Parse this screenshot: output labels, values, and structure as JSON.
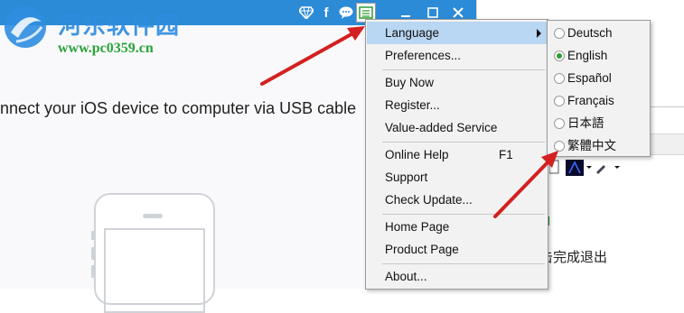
{
  "watermark": {
    "title": "河东软件园",
    "url": "www.pc0359.cn"
  },
  "app": {
    "connect_text": "nnect your iOS device to computer via USB cable"
  },
  "titlebar_icons": [
    "diamond-icon",
    "facebook-icon",
    "chat-icon",
    "menu-icon",
    "minimize-icon",
    "maximize-icon",
    "close-icon"
  ],
  "menu": {
    "language": "Language",
    "preferences": "Preferences...",
    "buy_now": "Buy Now",
    "register": "Register...",
    "value_added": "Value-added Service",
    "online_help": "Online Help",
    "online_help_shortcut": "F1",
    "support": "Support",
    "check_update": "Check Update...",
    "home_page": "Home Page",
    "product_page": "Product Page",
    "about": "About..."
  },
  "languages": [
    {
      "label": "Deutsch",
      "selected": false
    },
    {
      "label": "English",
      "selected": true
    },
    {
      "label": "Español",
      "selected": false
    },
    {
      "label": "Français",
      "selected": false
    },
    {
      "label": "日本語",
      "selected": false
    },
    {
      "label": "繁體中文",
      "selected": false
    }
  ],
  "background_window": {
    "chinese_text": "击完成退出"
  },
  "colors": {
    "titlebar": "#2b8bd7",
    "menu_highlight": "#b9d6f2",
    "arrow": "#d42020",
    "radio_selected": "#2e9e32"
  }
}
